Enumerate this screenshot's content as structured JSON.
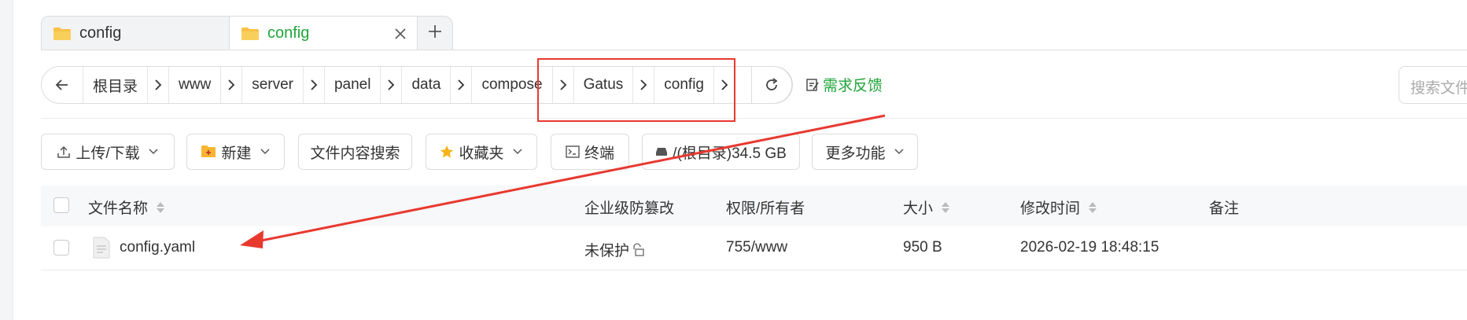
{
  "tabs": [
    {
      "label": "config",
      "active": false
    },
    {
      "label": "config",
      "active": true
    }
  ],
  "breadcrumb": [
    "根目录",
    "www",
    "server",
    "panel",
    "data",
    "compose",
    "Gatus",
    "config"
  ],
  "feedback_label": "需求反馈",
  "search": {
    "placeholder": "搜索文件/"
  },
  "toolbar": {
    "upload_download": "上传/下载",
    "new": "新建",
    "content_search": "文件内容搜索",
    "favorites": "收藏夹",
    "terminal": "终端",
    "disk": "/(根目录)34.5 GB",
    "more": "更多功能"
  },
  "table": {
    "columns": {
      "name": "文件名称",
      "protect": "企业级防篡改",
      "perm": "权限/所有者",
      "size": "大小",
      "mtime": "修改时间",
      "note": "备注"
    },
    "rows": [
      {
        "name": "config.yaml",
        "protect": "未保护",
        "perm": "755/www",
        "size": "950 B",
        "mtime": "2026-02-19 18:48:15",
        "note": ""
      }
    ]
  },
  "colors": {
    "accent": "#20a53a",
    "annotation": "#e8392f",
    "folder": "#f7c247"
  }
}
